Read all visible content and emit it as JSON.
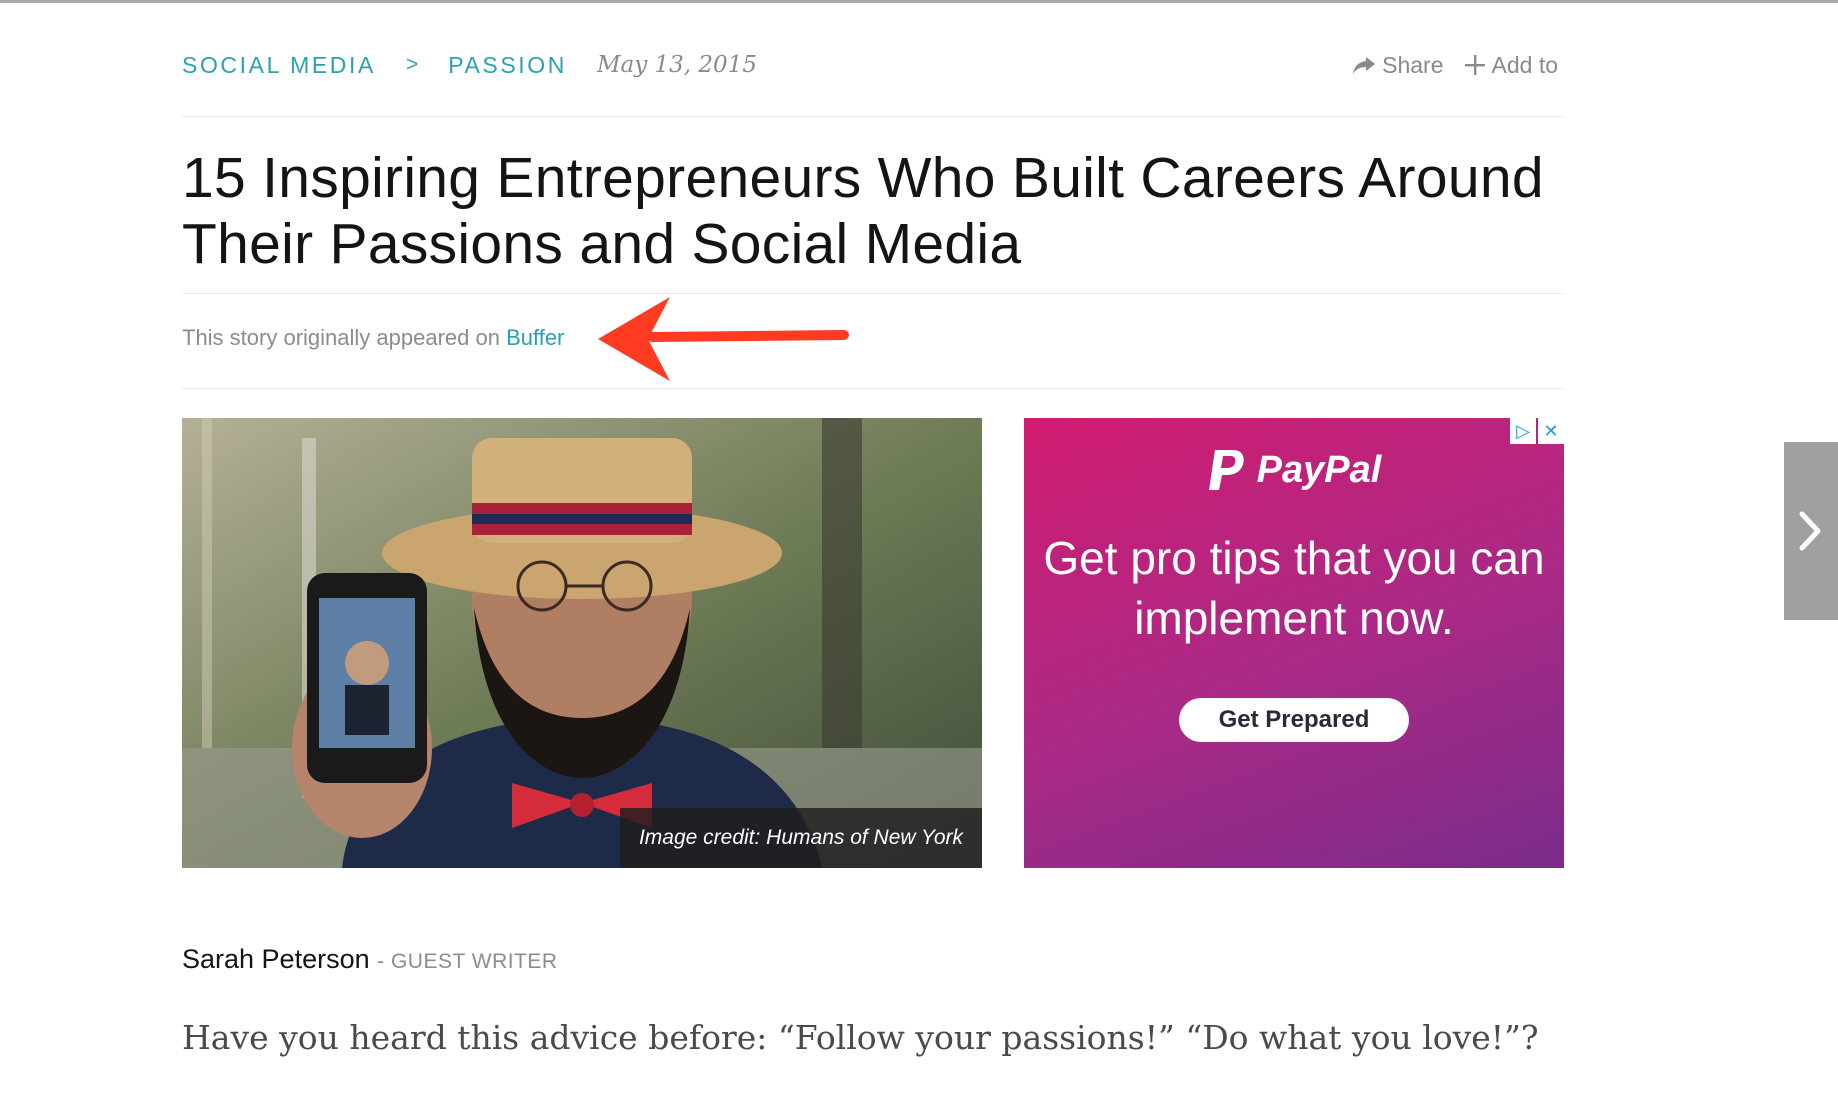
{
  "breadcrumb": {
    "items": [
      "SOCIAL MEDIA",
      "PASSION"
    ],
    "separator": ">",
    "date": "May 13, 2015"
  },
  "actions": {
    "share_label": "Share",
    "add_label": "Add to"
  },
  "headline": "15 Inspiring Entrepreneurs Who Built Careers Around Their Passions and Social Media",
  "source": {
    "prefix": "This story originally appeared on",
    "link_label": "Buffer"
  },
  "hero_image": {
    "credit": "Image credit: Humans of New York"
  },
  "ad": {
    "brand": "PayPal",
    "text": "Get pro tips that you can implement now.",
    "cta": "Get Prepared",
    "background_color": "#c0237c"
  },
  "byline": {
    "author": "Sarah Peterson",
    "role": "- GUEST WRITER"
  },
  "lede": "Have you heard this advice before: “Follow your passions!” “Do what you love!”?",
  "colors": {
    "accent": "#2aa1b3",
    "annotation_arrow": "#ff3b22"
  }
}
